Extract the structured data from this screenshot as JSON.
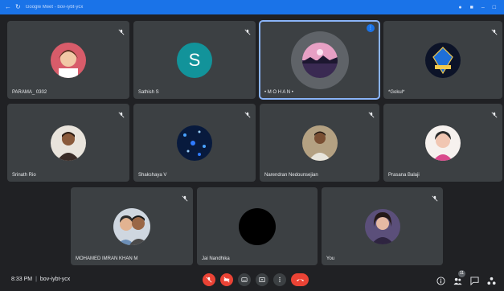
{
  "browser": {
    "url_text": "Google Meet - bov-iybt-ycx"
  },
  "participants": [
    {
      "name": "PARAMA_ 0302",
      "avatar": "photo-child"
    },
    {
      "name": "Sathish S",
      "avatar_letter": "S"
    },
    {
      "name": "• M O H A N •",
      "avatar": "photo-sunset"
    },
    {
      "name": "*Gokul*",
      "avatar": "photo-emblem"
    },
    {
      "name": "Srinath Rio",
      "avatar": "photo-man"
    },
    {
      "name": "Shakshaya V",
      "avatar": "photo-space"
    },
    {
      "name": "Narendran Nedounsejian",
      "avatar": "photo-man"
    },
    {
      "name": "Prasana Balaji",
      "avatar": "photo-cartoon"
    },
    {
      "name": "MOHAMED IMRAN KHAN M",
      "avatar": "photo-couple"
    },
    {
      "name": "Jai Nandhika",
      "avatar": "black-circle"
    },
    {
      "name": "You",
      "avatar": "photo-woman"
    }
  ],
  "meeting": {
    "time": "8:33 PM",
    "separator": "|",
    "code": "bov-iybt-ycx"
  },
  "people_count": "11",
  "colors": {
    "background": "#202124",
    "tile": "#3c4043",
    "accent": "#1a73e8",
    "danger": "#ea4335",
    "speaking_outline": "#8ab4f8"
  }
}
